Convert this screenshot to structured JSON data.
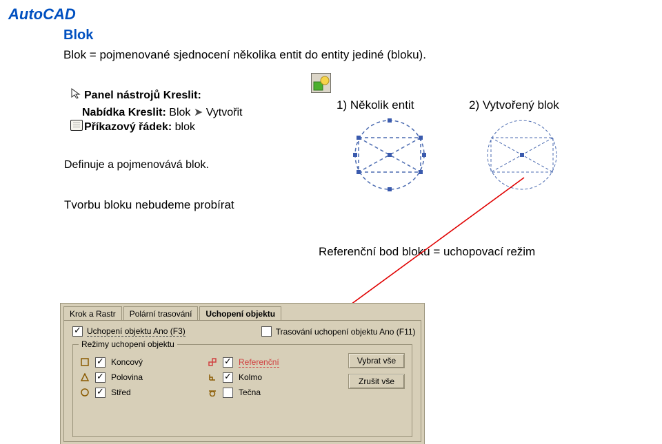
{
  "header": {
    "title": "AutoCAD",
    "subtitle": "Blok"
  },
  "definition": "Blok = pojmenované sjednocení několika entit do entity jediné (bloku).",
  "panel_line": {
    "label": "Panel nástrojů Kreslit:"
  },
  "nabidka": {
    "label": "Nabídka Kreslit:",
    "val1": "Blok",
    "val2": "Vytvořit"
  },
  "prikaz": {
    "label": "Příkazový řádek:",
    "value": "blok"
  },
  "defpoj": "Definuje a pojmenovává blok.",
  "fig1_label": "1) Několik entit",
  "fig2_label": "2) Vytvořený blok",
  "tvorbu": "Tvorbu bloku nebudeme probírat",
  "ref_line": "Referenční bod bloku = uchopovací režim",
  "dialog": {
    "tabs": [
      "Krok a Rastr",
      "Polární trasování",
      "Uchopení objektu"
    ],
    "top1": "Uchopení objektu Ano (F3)",
    "top2": "Trasování uchopení objektu Ano (F11)",
    "group_title": "Režimy uchopení objektu",
    "items_col1": [
      {
        "sym": "sq",
        "checked": true,
        "label": "Koncový"
      },
      {
        "sym": "tri",
        "checked": true,
        "label": "Polovina"
      },
      {
        "sym": "cir",
        "checked": true,
        "label": "Střed"
      }
    ],
    "items_col2": [
      {
        "sym": "ref",
        "checked": true,
        "label": "Referenční",
        "highlight": true
      },
      {
        "sym": "per",
        "checked": true,
        "label": "Kolmo"
      },
      {
        "sym": "tan",
        "checked": false,
        "label": "Tečna"
      }
    ],
    "btn1": "Vybrat vše",
    "btn2": "Zrušit vše"
  }
}
